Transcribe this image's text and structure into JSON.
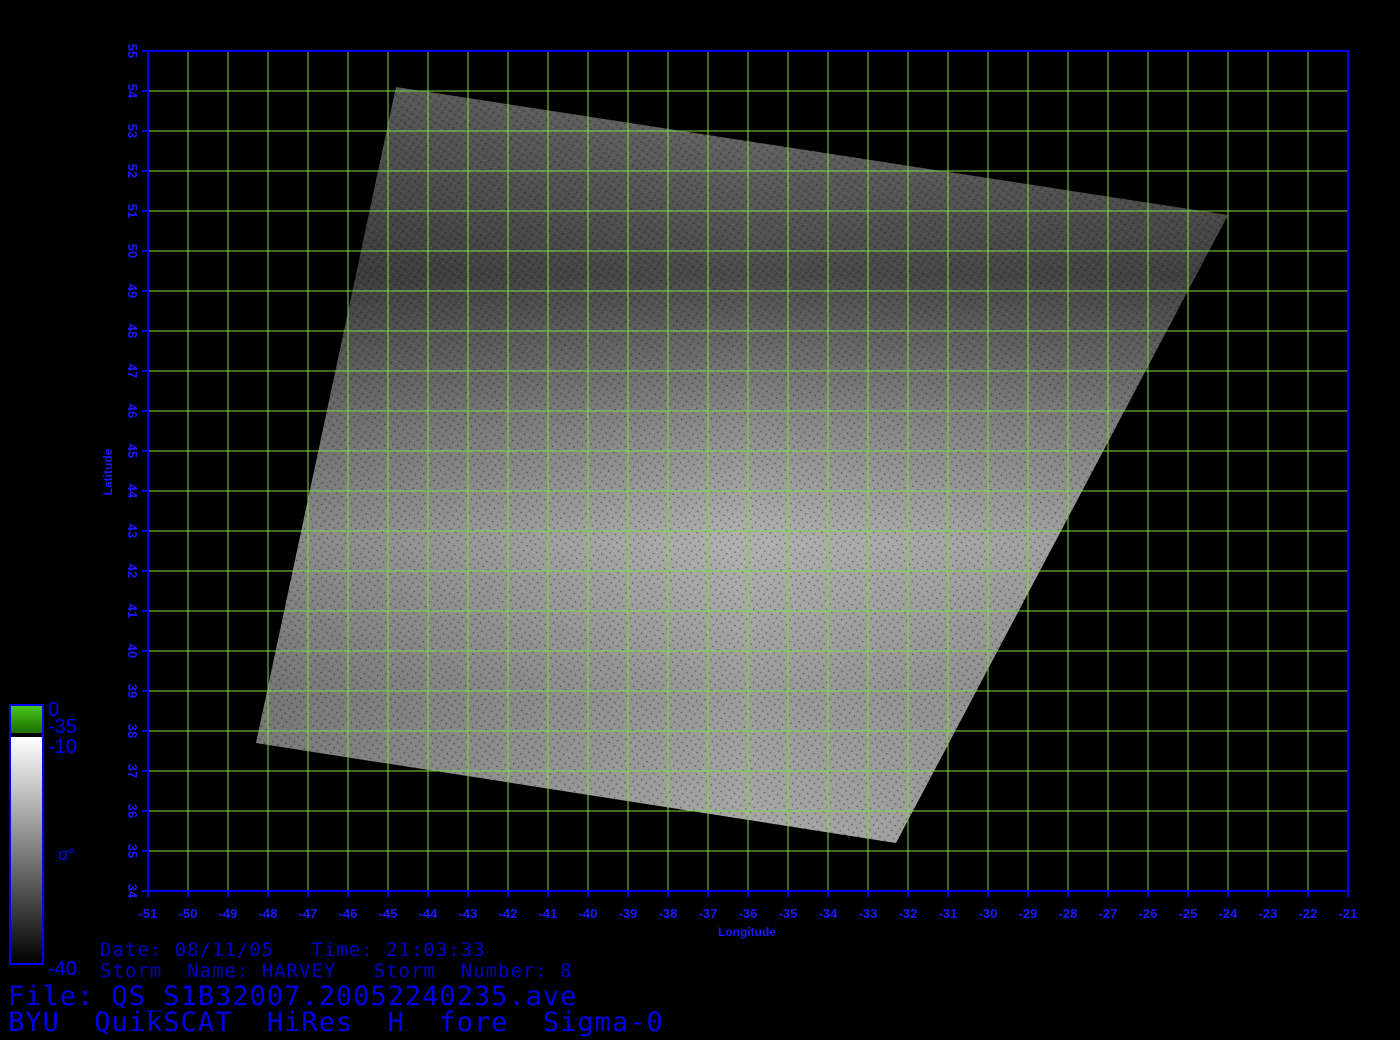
{
  "map": {
    "lon_range": [
      -51,
      -21
    ],
    "lat_range": [
      34,
      55
    ],
    "lon_ticks": [
      -51,
      -50,
      -49,
      -48,
      -47,
      -46,
      -45,
      -44,
      -43,
      -42,
      -41,
      -40,
      -39,
      -38,
      -37,
      -36,
      -35,
      -34,
      -33,
      -32,
      -31,
      -30,
      -29,
      -28,
      -27,
      -26,
      -25,
      -24,
      -23,
      -22,
      -21
    ],
    "lat_ticks": [
      34,
      35,
      36,
      37,
      38,
      39,
      40,
      41,
      42,
      43,
      44,
      45,
      46,
      47,
      48,
      49,
      50,
      51,
      52,
      53,
      54,
      55
    ],
    "xlabel": "Longitude",
    "ylabel": "Latitude",
    "swath_corners_lonlat": [
      [
        -44.8,
        54.1
      ],
      [
        -24.0,
        50.9
      ],
      [
        -32.3,
        35.2
      ],
      [
        -48.3,
        37.7
      ]
    ],
    "grid_color": "#7fdc3c",
    "axis_color": "#0000ff",
    "tick_label_color": "#1a1aff"
  },
  "colorbar": {
    "labels": [
      "0",
      "-35",
      "-10",
      "-40"
    ],
    "symbol": "σ°",
    "colors": [
      "#2e9a00",
      "#ffffff",
      "#000000"
    ]
  },
  "info": {
    "line1": "Date: 08/11/05   Time: 21:03:33",
    "line2": "Storm  Name: HARVEY   Storm  Number: 8",
    "line3": "File: QS_S1B32007.20052240235.ave",
    "line4": "BYU  QuikSCAT  HiRes  H  fore  Sigma-0"
  }
}
